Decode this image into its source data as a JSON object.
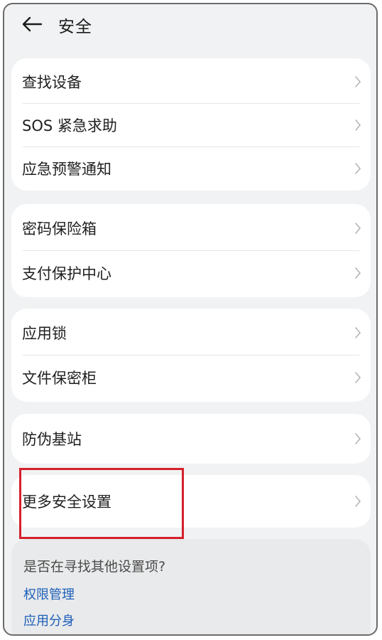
{
  "header": {
    "title": "安全",
    "back_icon": "arrow-left-icon"
  },
  "groups": [
    {
      "items": [
        {
          "label": "查找设备"
        },
        {
          "label": "SOS 紧急求助"
        },
        {
          "label": "应急预警通知"
        }
      ]
    },
    {
      "items": [
        {
          "label": "密码保险箱"
        },
        {
          "label": "支付保护中心"
        }
      ]
    },
    {
      "items": [
        {
          "label": "应用锁"
        },
        {
          "label": "文件保密柜"
        }
      ]
    },
    {
      "items": [
        {
          "label": "防伪基站"
        }
      ]
    },
    {
      "items": [
        {
          "label": "更多安全设置"
        }
      ]
    }
  ],
  "suggestions": {
    "question": "是否在寻找其他设置项?",
    "links": [
      {
        "label": "权限管理"
      },
      {
        "label": "应用分身"
      }
    ]
  },
  "colors": {
    "highlight_box": "#d5202b",
    "link": "#1d5fb8",
    "background": "#f1f2f3"
  }
}
